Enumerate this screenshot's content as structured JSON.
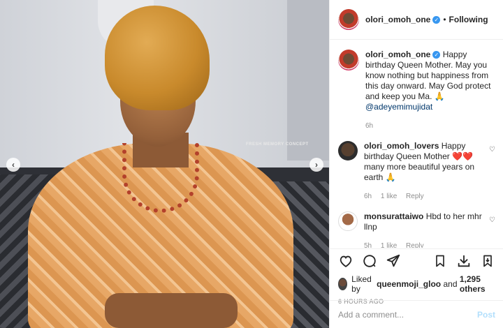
{
  "photo": {
    "watermark": "FRESH MEMORY CONCEPT",
    "prev_icon": "chevron-left-icon",
    "next_icon": "chevron-right-icon"
  },
  "header": {
    "username": "olori_omoh_one",
    "separator": "•",
    "follow_status": "Following"
  },
  "caption": {
    "username": "olori_omoh_one",
    "text": "Happy birthday Queen Mother. May you know nothing but happiness from this day onward. May God protect and keep you Ma. 🙏",
    "mention": "@adeyemimujidat",
    "time": "6h"
  },
  "comments": [
    {
      "username": "olori_omoh_lovers",
      "text": "Happy birthday Queen Mother ❤️❤️ many more beautiful years on earth 🙏",
      "time": "6h",
      "likes": "1 like",
      "reply": "Reply"
    },
    {
      "username": "monsurattaiwo",
      "text": "Hbd to her mhr llnp",
      "time": "5h",
      "likes": "1 like",
      "reply": "Reply"
    }
  ],
  "likes": {
    "prefix": "Liked by",
    "user": "queenmoji_gloo",
    "and": "and",
    "others": "1,295 others"
  },
  "timestamp": "6 HOURS AGO",
  "add_comment": {
    "placeholder": "Add a comment...",
    "post_label": "Post"
  }
}
